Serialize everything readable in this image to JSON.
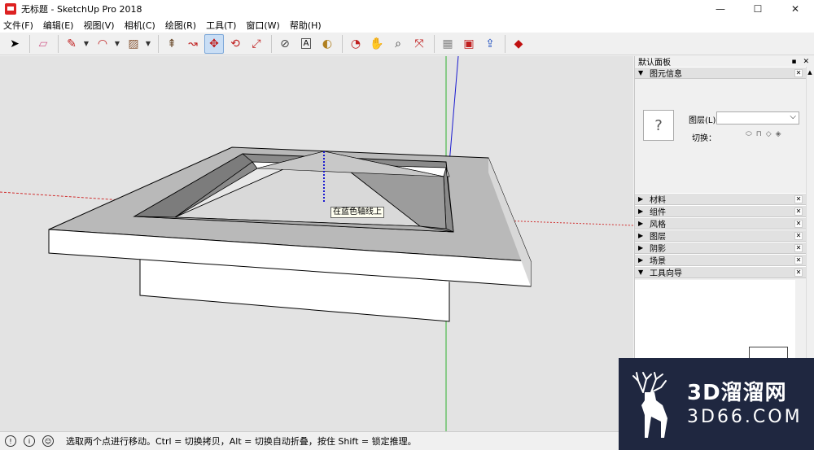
{
  "app": {
    "title": "无标题 - SketchUp Pro 2018",
    "window_controls": {
      "minimize": "—",
      "maximize": "☐",
      "close": "✕"
    }
  },
  "menu": [
    "文件(F)",
    "编辑(E)",
    "视图(V)",
    "相机(C)",
    "绘图(R)",
    "工具(T)",
    "窗口(W)",
    "帮助(H)"
  ],
  "toolbar": {
    "tools": [
      {
        "name": "select-icon",
        "glyph": "➤"
      },
      {
        "name": "eraser-icon",
        "glyph": "▱"
      },
      {
        "name": "pencil-icon",
        "glyph": "✎"
      },
      {
        "name": "arc-icon",
        "glyph": "◠"
      },
      {
        "name": "rectangle-icon",
        "glyph": "▨"
      },
      {
        "name": "push-pull-icon",
        "glyph": "⇞"
      },
      {
        "name": "follow-me-icon",
        "glyph": "↝"
      },
      {
        "name": "move-icon",
        "glyph": "✥"
      },
      {
        "name": "rotate-icon",
        "glyph": "⟲"
      },
      {
        "name": "scale-icon",
        "glyph": "⤢"
      },
      {
        "name": "tape-measure-icon",
        "glyph": "⊘"
      },
      {
        "name": "text-icon",
        "glyph": "A"
      },
      {
        "name": "paint-bucket-icon",
        "glyph": "◐"
      },
      {
        "name": "orbit-icon",
        "glyph": "◔"
      },
      {
        "name": "pan-icon",
        "glyph": "✋"
      },
      {
        "name": "zoom-icon",
        "glyph": "⌕"
      },
      {
        "name": "zoom-extents-icon",
        "glyph": "⤧"
      },
      {
        "name": "warehouse-icon",
        "glyph": "▦"
      },
      {
        "name": "extension-warehouse-icon",
        "glyph": "▣"
      },
      {
        "name": "share-model-icon",
        "glyph": "⇪"
      },
      {
        "name": "ruby-icon",
        "glyph": "◆"
      }
    ]
  },
  "viewport": {
    "tooltip": "在蓝色轴线上",
    "colors": {
      "background": "#e3e3e3",
      "blue_axis": "#1a1ad0",
      "green_axis": "#2fb02f",
      "red_axis": "#d03030"
    }
  },
  "panel": {
    "title": "默认面板",
    "pin": "▪",
    "close": "✕",
    "entity_info": {
      "title": "图元信息",
      "thumb": "?",
      "layer_label": "图层(L):",
      "toggle_label": "切换："
    },
    "sections": [
      "材料",
      "组件",
      "风格",
      "图层",
      "阴影",
      "场景"
    ],
    "instructor": "工具向导"
  },
  "status": {
    "text": "选取两个点进行移动。Ctrl = 切换拷贝，Alt = 切换自动折叠，按住 Shift = 锁定推理。"
  },
  "watermark": {
    "main": "3D溜溜网",
    "sub": "3D66.COM"
  }
}
